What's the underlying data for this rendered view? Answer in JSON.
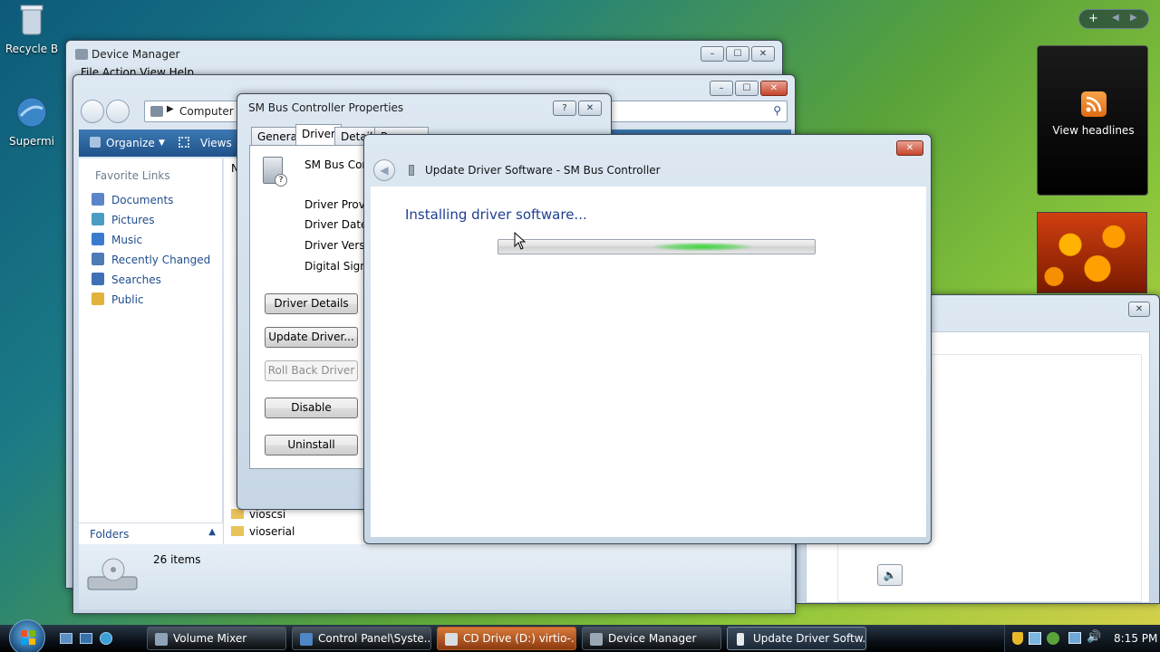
{
  "desktop": {
    "recycle_bin": "Recycle B",
    "supermicro": "Supermi"
  },
  "sidebar_gadgets": {
    "feed_label": "View headlines"
  },
  "explorer": {
    "device_manager_title": "Device Manager",
    "device_manager_menu": "File  Action  View  Help",
    "address": "Computer",
    "toolbar_organize": "Organize",
    "toolbar_views": "Views",
    "favorite_links_header": "Favorite Links",
    "links": [
      {
        "label": "Documents",
        "color": "#5b85c9"
      },
      {
        "label": "Pictures",
        "color": "#4a9dc2"
      },
      {
        "label": "Music",
        "color": "#3a7bd0"
      },
      {
        "label": "Recently Changed",
        "color": "#4d7bb8"
      },
      {
        "label": "Searches",
        "color": "#3f70b5"
      },
      {
        "label": "Public",
        "color": "#e2b33c"
      }
    ],
    "folders_label": "Folders",
    "files": [
      "vioscsi",
      "vioserial"
    ],
    "column_letter": "N",
    "item_count": "26 items"
  },
  "properties": {
    "title": "SM Bus Controller Properties",
    "tabs": [
      "General",
      "Driver",
      "Detail",
      "R"
    ],
    "device_name": "SM Bus Contr",
    "labels": [
      "Driver Provide",
      "Driver Date:",
      "Driver Version",
      "Digital Signer:"
    ],
    "buttons": {
      "details": "Driver Details",
      "update": "Update Driver...",
      "rollback": "Roll Back Driver",
      "disable": "Disable",
      "uninstall": "Uninstall"
    }
  },
  "wizard": {
    "title": "Update Driver Software - SM Bus Controller",
    "heading": "Installing driver software...",
    "progress_state": "indeterminate",
    "accent": "#2b9a2b"
  },
  "taskbar": {
    "items": [
      "Volume Mixer",
      "Control Panel\\Syste...",
      "CD Drive (D:) virtio-...",
      "Device Manager",
      "Update Driver Softw..."
    ],
    "clock": "8:15 PM"
  }
}
